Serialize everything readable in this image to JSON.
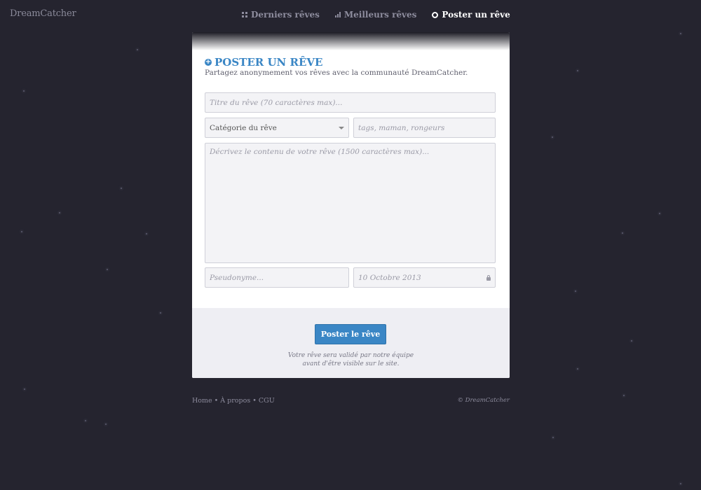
{
  "header": {
    "logo": "DreamCatcher",
    "nav": [
      {
        "label": "Derniers rêves",
        "icon": "grid-icon"
      },
      {
        "label": "Meilleurs rêves",
        "icon": "bar-chart-icon"
      },
      {
        "label": "Poster un rêve",
        "icon": "circle-icon",
        "active": true
      }
    ]
  },
  "form": {
    "title": "POSTER UN RÊVE",
    "subtitle": "Partagez anonymement vos rêves avec la communauté DreamCatcher.",
    "title_placeholder": "Titre du rêve (70 caractères max)...",
    "category_value": "Catégorie du rêve",
    "tags_placeholder": "tags, maman, rongeurs",
    "description_placeholder": "Décrivez le contenu de votre rêve (1500 caractères max)...",
    "pseudonym_placeholder": "Pseudonyme...",
    "date_value": "10 Octobre 2013",
    "submit_label": "Poster le rêve",
    "note_line1": "Votre rêve sera validé par notre équipe",
    "note_line2": "avant d'être visible sur le site."
  },
  "footer": {
    "links": [
      "Home",
      "À propos",
      "CGU"
    ],
    "separator": " • ",
    "copyright": "© DreamCatcher"
  },
  "colors": {
    "background": "#25242f",
    "accent": "#3a86c5"
  }
}
